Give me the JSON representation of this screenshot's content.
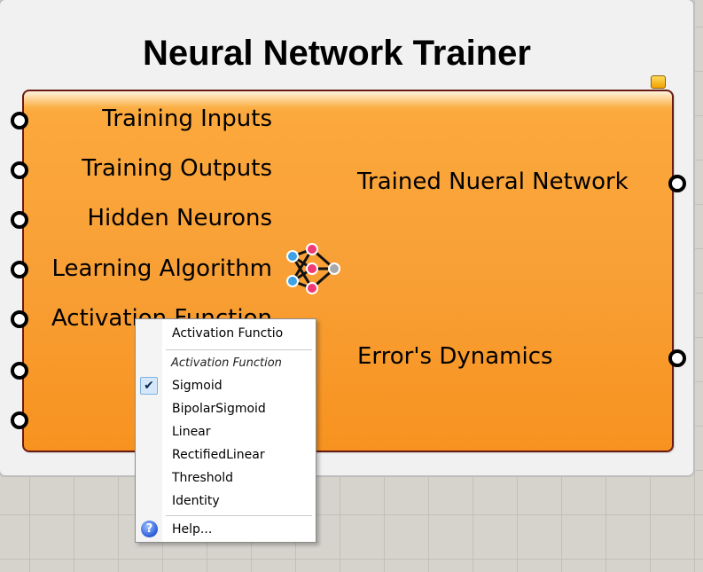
{
  "window": {
    "title": "Neural Network Trainer"
  },
  "component": {
    "inputs": [
      {
        "label": "Training Inputs"
      },
      {
        "label": "Training Outputs"
      },
      {
        "label": "Hidden Neurons"
      },
      {
        "label": "Learning Algorithm"
      },
      {
        "label": "Activation Function"
      }
    ],
    "outputs": [
      {
        "label": "Trained Nueral Network"
      },
      {
        "label": "Error's Dynamics"
      }
    ],
    "icon": "neural-network-icon",
    "warning_badge": "warning-badge"
  },
  "context_menu": {
    "name_field": "Activation Functio",
    "section_header": "Activation Function",
    "options": [
      "Sigmoid",
      "BipolarSigmoid",
      "Linear",
      "RectifiedLinear",
      "Threshold",
      "Identity"
    ],
    "selected": "Sigmoid",
    "help_label": "Help...",
    "check_icon": "checkmark-icon",
    "help_icon": "help-icon"
  },
  "colors": {
    "component_fill": "#f8a036",
    "component_border": "#6b1a12",
    "canvas_bg": "#d6d3cd",
    "group_bg": "#f1f1f1"
  }
}
